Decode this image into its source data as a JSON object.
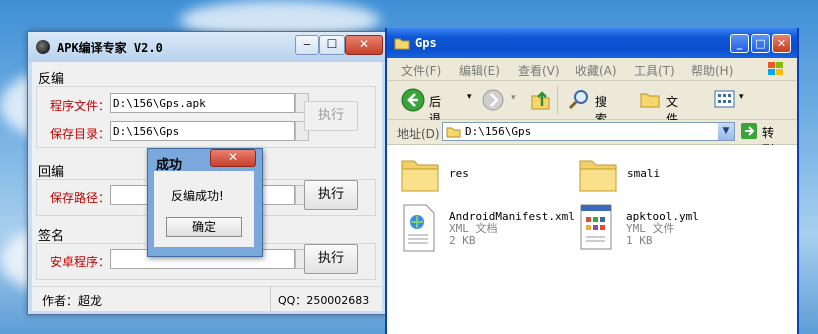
{
  "apk_window": {
    "title": "APK编译专家 V2.0",
    "min": "▭",
    "max": "☐",
    "close": "✕",
    "decompile": {
      "section": "反编",
      "program_label": "程序文件：",
      "program_value": "D:\\156\\Gps.apk",
      "save_dir_label": "保存目录：",
      "save_dir_value": "D:\\156\\Gps",
      "exec": "执行"
    },
    "compile": {
      "section": "回编",
      "save_path_label": "保存路径：",
      "save_path_value": "",
      "exec": "执行"
    },
    "sign": {
      "section": "签名",
      "app_label": "安卓程序：",
      "app_value": "",
      "exec": "执行"
    },
    "status": {
      "author": "作者：超龙",
      "qq": "QQ：250002683"
    }
  },
  "dialog": {
    "title": "成功",
    "close": "✕",
    "message": "反编成功!",
    "ok": "确定"
  },
  "explorer": {
    "title": "Gps",
    "min": "_",
    "max": "□",
    "close": "✕",
    "menu": [
      "文件(F)",
      "编辑(E)",
      "查看(V)",
      "收藏(A)",
      "工具(T)",
      "帮助(H)"
    ],
    "back": "后退",
    "search": "搜索",
    "folders": "文件夹",
    "address_label": "地址(D)",
    "address_value": "D:\\156\\Gps",
    "go": "转到",
    "files": [
      {
        "name": "res",
        "type": "",
        "size": "",
        "icon": "folder-icon"
      },
      {
        "name": "smali",
        "type": "",
        "size": "",
        "icon": "folder-icon"
      },
      {
        "name": "AndroidManifest.xml",
        "type": "XML 文档",
        "size": "2 KB",
        "icon": "xml-document-icon"
      },
      {
        "name": "apktool.yml",
        "type": "YML 文件",
        "size": "1 KB",
        "icon": "yml-file-icon"
      }
    ]
  },
  "colors": {
    "label_red": "#c00000",
    "xp_blue": "#0a4fcc",
    "menubar": "#ece9d8"
  }
}
